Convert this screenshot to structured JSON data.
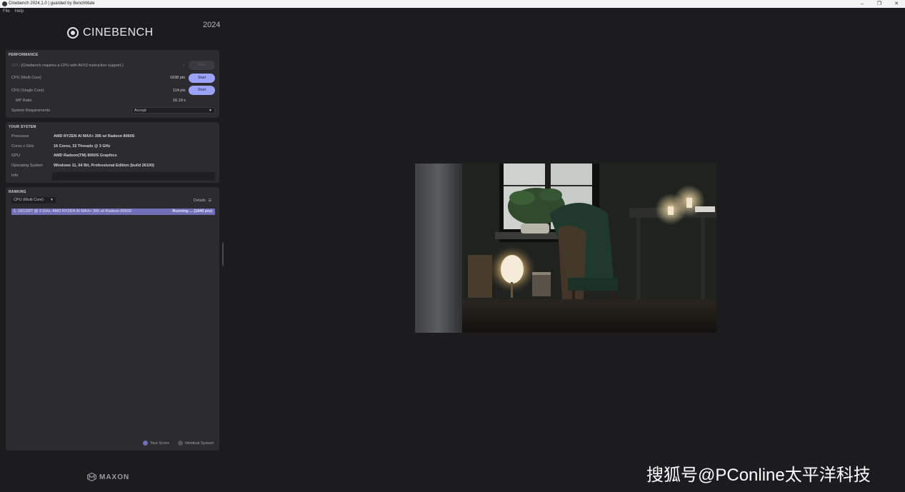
{
  "window": {
    "title": "Cinebench 2024.1.0 | guarded by BenchMate",
    "controls": [
      "–",
      "❐",
      "✕"
    ]
  },
  "menu": [
    "File",
    "Help"
  ],
  "brand": {
    "name": "CINEBENCH",
    "year": "2024"
  },
  "performance": {
    "title": "PERFORMANCE",
    "gpu": {
      "label": "GPU",
      "note": "(Cinebench requires a CPU with AVX2 instruction support.)",
      "score": "-",
      "button": "Start"
    },
    "cpu_multi": {
      "label": "CPU (Multi Core)",
      "score": "1838 pts",
      "button": "Start"
    },
    "cpu_single": {
      "label": "CPU (Single Core)",
      "score": "114 pts",
      "button": "Start"
    },
    "mp_ratio": {
      "label": "MP Ratio",
      "value": "16.19 x"
    },
    "system_requirements": {
      "label": "System Requirements",
      "value": "Accept"
    }
  },
  "your_system": {
    "title": "YOUR SYSTEM",
    "rows": [
      {
        "label": "Processor",
        "value": "AMD RYZEN AI MAX+ 395 w/ Radeon 8060S"
      },
      {
        "label": "Cores x GHz",
        "value": "16 Cores, 32 Threads @ 3 GHz"
      },
      {
        "label": "GPU",
        "value": "AMD Radeon(TM) 8060S Graphics"
      },
      {
        "label": "Operating System",
        "value": "Windows 11, 64 Bit, Professional Edition (build 26100)"
      },
      {
        "label": "Info",
        "value": ""
      }
    ]
  },
  "ranking": {
    "title": "RANKING",
    "dropdown": "CPU (Multi Core)",
    "details": "Details",
    "entries": [
      {
        "text": "1. 16C/32T @ 3 GHz, AMD RYZEN AI MAX+ 395 w/ Radeon 8060S",
        "status": "Running ... (1840 pts)"
      }
    ],
    "legend": {
      "your_score": "Your Score",
      "identical": "Identical System"
    }
  },
  "footer_brand": "MAXON",
  "watermark": "搜狐号@PConline太平洋科技",
  "colors": {
    "accent": "#9aa3f5",
    "rank_highlight": "#6f70b8",
    "panel": "#2b2b30",
    "background": "#1c1c1f"
  }
}
